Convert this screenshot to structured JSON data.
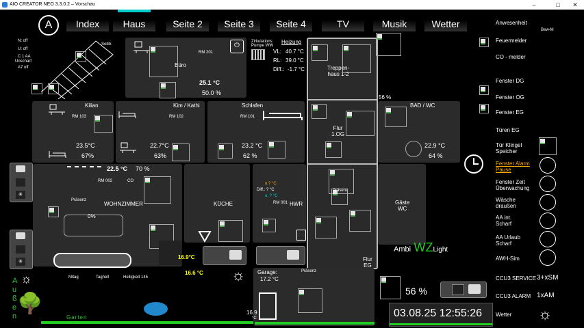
{
  "window": {
    "title": "AIO CREATOR NEO 3.3.0.2 – Vorschau",
    "minimize": "–",
    "maximize": "□",
    "close": "✕"
  },
  "tabs": [
    "Index",
    "Haus",
    "Seite 2",
    "Seite 3",
    "Seite 4",
    "TV",
    "Musik",
    "Wetter"
  ],
  "stairs": {
    "sensors": [
      "N: off",
      "U: off",
      "C 1 AA",
      "Unscharf",
      "A7 off"
    ],
    "label": "Seitlk"
  },
  "buero": {
    "name": "Büro",
    "room": "RM 201",
    "temp": "25.1 °C",
    "hum": "50.0 %"
  },
  "heating": {
    "title": "Heizung",
    "subtitle1": "Zirkulations",
    "subtitle2": "Pumpe WW",
    "vl_label": "VL:",
    "vl": "40.7 °C",
    "rl_label": "RL:",
    "rl": "39.0 °C",
    "diff_label": "Diff.:",
    "diff": "-1.7 °C"
  },
  "stairhouse": {
    "name": "Treppen-\nhaus 1-2"
  },
  "flur1": {
    "name": "Flur\n1.OG"
  },
  "kilian": {
    "name": "Kilian",
    "room": "RM 103",
    "temp": "23.5°C",
    "hum": "67%"
  },
  "kim": {
    "name": "Kim / Kathi",
    "room": "RM 102",
    "temp": "22.7°C",
    "hum": "63%"
  },
  "schlafen": {
    "name": "Schlafen",
    "room": "RM 101",
    "temp": "23.2 °C",
    "hum": "62 %"
  },
  "bad": {
    "name": "BAD / WC",
    "temp": "22.9 °C",
    "hum": "64 %",
    "extra": "56 %"
  },
  "wohn": {
    "name": "WOHNZIMMER",
    "temp": "22.5 °C",
    "hum": "70 %",
    "room": "RM 002",
    "co": "CO",
    "presence": "Präsenz",
    "dim": "0%"
  },
  "kueche": {
    "name": "KÜCHE"
  },
  "hwr": {
    "name": "HWR",
    "room": "RM 001",
    "l1": "u:? °C",
    "l2": "Diff.: ? °C",
    "l3": "u: ? °C"
  },
  "gaeste": {
    "name": "Gäste\nWC",
    "presence": "Präsenz"
  },
  "flurEG": {
    "name": "Flur\nEG"
  },
  "ambi": {
    "a": "Ambi",
    "wz": "WZ",
    "light": "Light"
  },
  "bottom": {
    "mitag": "Mitag",
    "taghell": "Taghell",
    "helligkeit": "Helligkeit 145",
    "garden_v": [
      "A",
      "u",
      "ß",
      "e",
      "n"
    ],
    "garten": "Garten",
    "t1": "16.9°C",
    "t2": "16.6 °C",
    "garage_lbl": "Garage:",
    "garage_t": "17.2 °C",
    "presence": "Präsenz",
    "t3": "16.9",
    "t3u": "°C"
  },
  "pct56": "56 %",
  "datetime": "03.08.25 12:55:26",
  "right": {
    "anwesenheit": "Anwesenheit",
    "bew": "Bew-M",
    "feuer": "Feuermelder",
    "co": "CO - melder",
    "fdg": "Fenster DG",
    "fog": "Fenster OG",
    "feg": "Fenster EG",
    "turen": "Türen EG",
    "klingel": "Tür Klingel\nSpeicher",
    "alarm": "Fenster Alarm\nPause",
    "zeit": "Fenster Zeit\nÜberwachung",
    "waesche": "Wäsche\ndraußen",
    "aaint": "AA int.\nScharf",
    "aaurl": "AA Urlaub\nScharf",
    "awh": "AWH-Sim",
    "ccu3s": "CCU3 SERVICE",
    "ccu3s_v": "3+xSM",
    "ccu3a": "CCU3 ALARM",
    "ccu3a_v": "1xAM",
    "wetter": "Wetter"
  },
  "colors": {
    "accent": "#00cccc",
    "green": "#22cc22",
    "yellow": "#ffff00",
    "orange": "#ffaa00"
  }
}
